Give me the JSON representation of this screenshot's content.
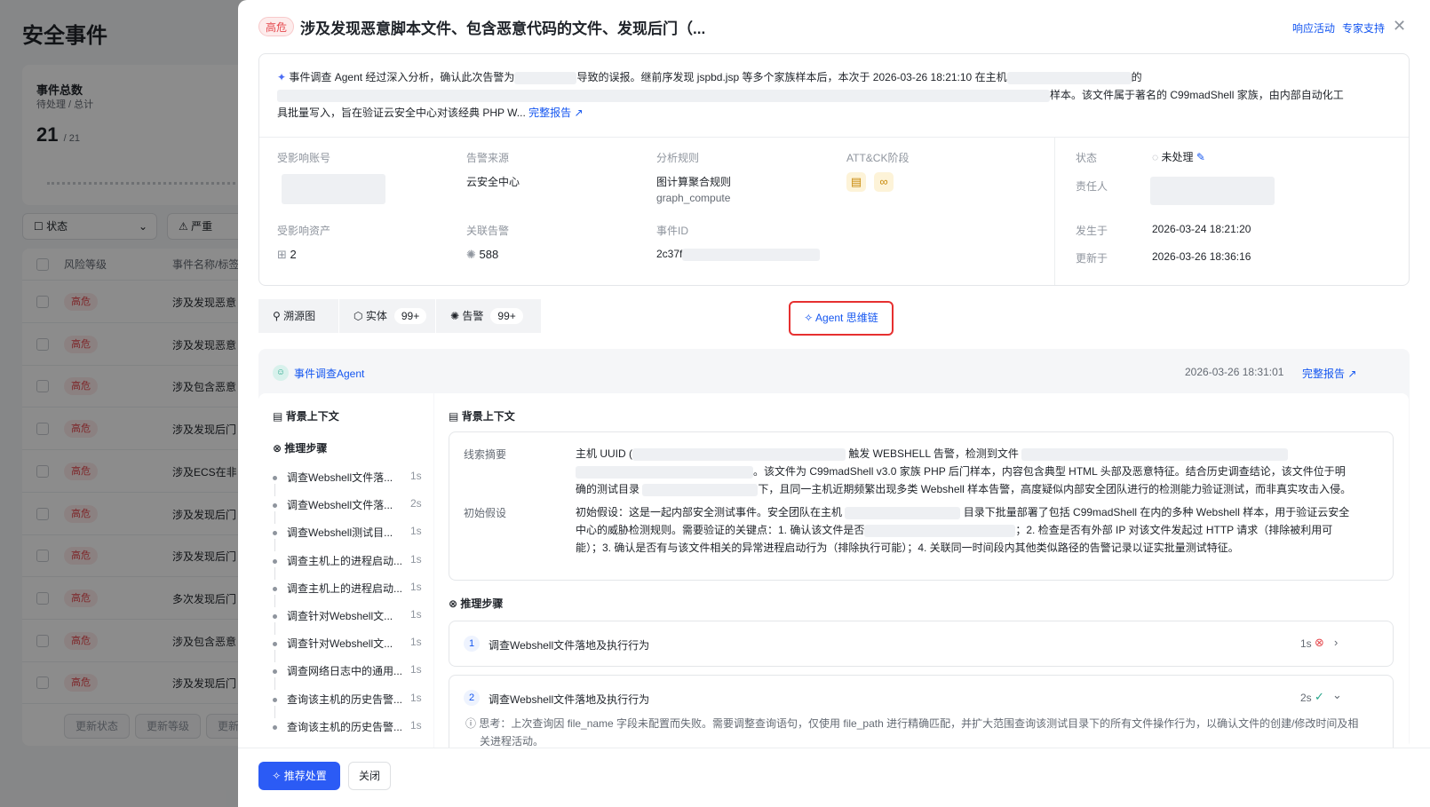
{
  "background": {
    "title": "安全事件",
    "stat": {
      "title": "事件总数",
      "sub": "待处理 / 总计",
      "num": "21",
      "total": "/ 21"
    },
    "filters": {
      "status": "状态",
      "severity": "严重"
    },
    "table": {
      "col_risk": "风险等级",
      "col_name": "事件名称/标签",
      "rows": [
        {
          "risk": "高危",
          "name": "涉及发现恶意"
        },
        {
          "risk": "高危",
          "name": "涉及发现恶意"
        },
        {
          "risk": "高危",
          "name": "涉及包含恶意"
        },
        {
          "risk": "高危",
          "name": "涉及发现后门"
        },
        {
          "risk": "高危",
          "name": "涉及ECS在非"
        },
        {
          "risk": "高危",
          "name": "涉及发现后门"
        },
        {
          "risk": "高危",
          "name": "涉及发现后门"
        },
        {
          "risk": "高危",
          "name": "多次发现后门"
        },
        {
          "risk": "高危",
          "name": "涉及包含恶意"
        },
        {
          "risk": "高危",
          "name": "涉及发现后门"
        }
      ]
    },
    "bulk": {
      "update_status": "更新状态",
      "update_level": "更新等级",
      "more": "更新"
    }
  },
  "drawer": {
    "badge": "高危",
    "title": "涉及发现恶意脚本文件、包含恶意代码的文件、发现后门（...",
    "links": {
      "respond": "响应活动",
      "expert": "专家支持"
    },
    "summary": {
      "p1": "事件调查 Agent 经过深入分析，确认此次告警为",
      "p2": "导致的误报。继前序发现 jspbd.jsp 等多个家族样本后，本次于 2026-03-26 18:21:10 在主机",
      "p3": "的",
      "p4": "样本。该文件属于著名的 C99madShell 家族，由内部自动化工",
      "p5": "具批量写入，旨在验证云安全中心对该经典 PHP W...",
      "full_report": "完整报告 ↗"
    },
    "fields": {
      "account_label": "受影响账号",
      "source_label": "告警来源",
      "source_value": "云安全中心",
      "rule_label": "分析规则",
      "rule_value": "图计算聚合规则",
      "rule_sub": "graph_compute",
      "attck_label": "ATT&CK阶段",
      "asset_label": "受影响资产",
      "asset_value": "2",
      "alert_label": "关联告警",
      "alert_value": "588",
      "event_id_label": "事件ID",
      "event_id_value": "2c37f",
      "status_label": "状态",
      "status_value": "未处理",
      "owner_label": "责任人",
      "occurred_label": "发生于",
      "occurred_value": "2026-03-24 18:21:20",
      "updated_label": "更新于",
      "updated_value": "2026-03-26 18:36:16"
    },
    "tabs": {
      "trace": "溯源图",
      "entity": "实体",
      "entity_count": "99+",
      "alert": "告警",
      "alert_count": "99+",
      "agent": "Agent 思维链"
    },
    "agent": {
      "name": "事件调查Agent",
      "time": "2026-03-26 18:31:01",
      "report": "完整报告 ↗",
      "left_ctx": "背景上下文",
      "left_steps": "推理步骤",
      "steps": [
        {
          "title": "调查Webshell文件落...",
          "dur": "1s"
        },
        {
          "title": "调查Webshell文件落...",
          "dur": "2s"
        },
        {
          "title": "调查Webshell测试目...",
          "dur": "1s"
        },
        {
          "title": "调查主机上的进程启动...",
          "dur": "1s"
        },
        {
          "title": "调查主机上的进程启动...",
          "dur": "1s"
        },
        {
          "title": "调查针对Webshell文...",
          "dur": "1s"
        },
        {
          "title": "调查针对Webshell文...",
          "dur": "1s"
        },
        {
          "title": "调查网络日志中的通用...",
          "dur": "1s"
        },
        {
          "title": "查询该主机的历史告警...",
          "dur": "1s"
        },
        {
          "title": "查询该主机的历史告警...",
          "dur": "1s"
        }
      ],
      "ctx_title": "背景上下文",
      "clue_label": "线索摘要",
      "clue_1a": "主机 UUID (",
      "clue_1b": "触发 WEBSHELL 告警，检测到文件",
      "clue_2": "。该文件为 C99madShell v3.0 家族 PHP 后门样本，内容包含典型 HTML 头部及恶意特征。结合历史调查结论，该文件位于明",
      "clue_3a": "确的测试目录",
      "clue_3b": "下，且同一主机近期频繁出现多类 Webshell 样本告警，高度疑似内部安全团队进行的检测能力验证测试，而非真实攻击入侵。",
      "hyp_label": "初始假设",
      "hyp_1a": "初始假设：这是一起内部安全测试事件。安全团队在主机",
      "hyp_1b": "目录下批量部署了包括 C99madShell 在内的多种 Webshell 样本，用于验证云安全",
      "hyp_2a": "中心的威胁检测规则。需要验证的关键点：1. 确认该文件是否",
      "hyp_2b": "；2. 检查是否有外部 IP 对该文件发起过 HTTP 请求（排除被利用可",
      "hyp_3": "能）；3. 确认是否有与该文件相关的异常进程启动行为（排除执行可能）；4. 关联同一时间段内其他类似路径的告警记录以证实批量测试特征。",
      "steps_title": "推理步骤",
      "card1_num": "1",
      "card1_title": "调查Webshell文件落地及执行行为",
      "card1_dur": "1s",
      "card2_num": "2",
      "card2_title": "调查Webshell文件落地及执行行为",
      "card2_dur": "2s",
      "card2_think": "思考：上次查询因 file_name 字段未配置而失败。需要调整查询语句，仅使用 file_path 进行精确匹配，并扩大范围查询该测试目录下的所有文件操作行为，以确认文件的创建/修改时间及相",
      "card2_think2": "关进程活动。"
    },
    "footer": {
      "recommend": "推荐处置",
      "close": "关闭"
    }
  }
}
